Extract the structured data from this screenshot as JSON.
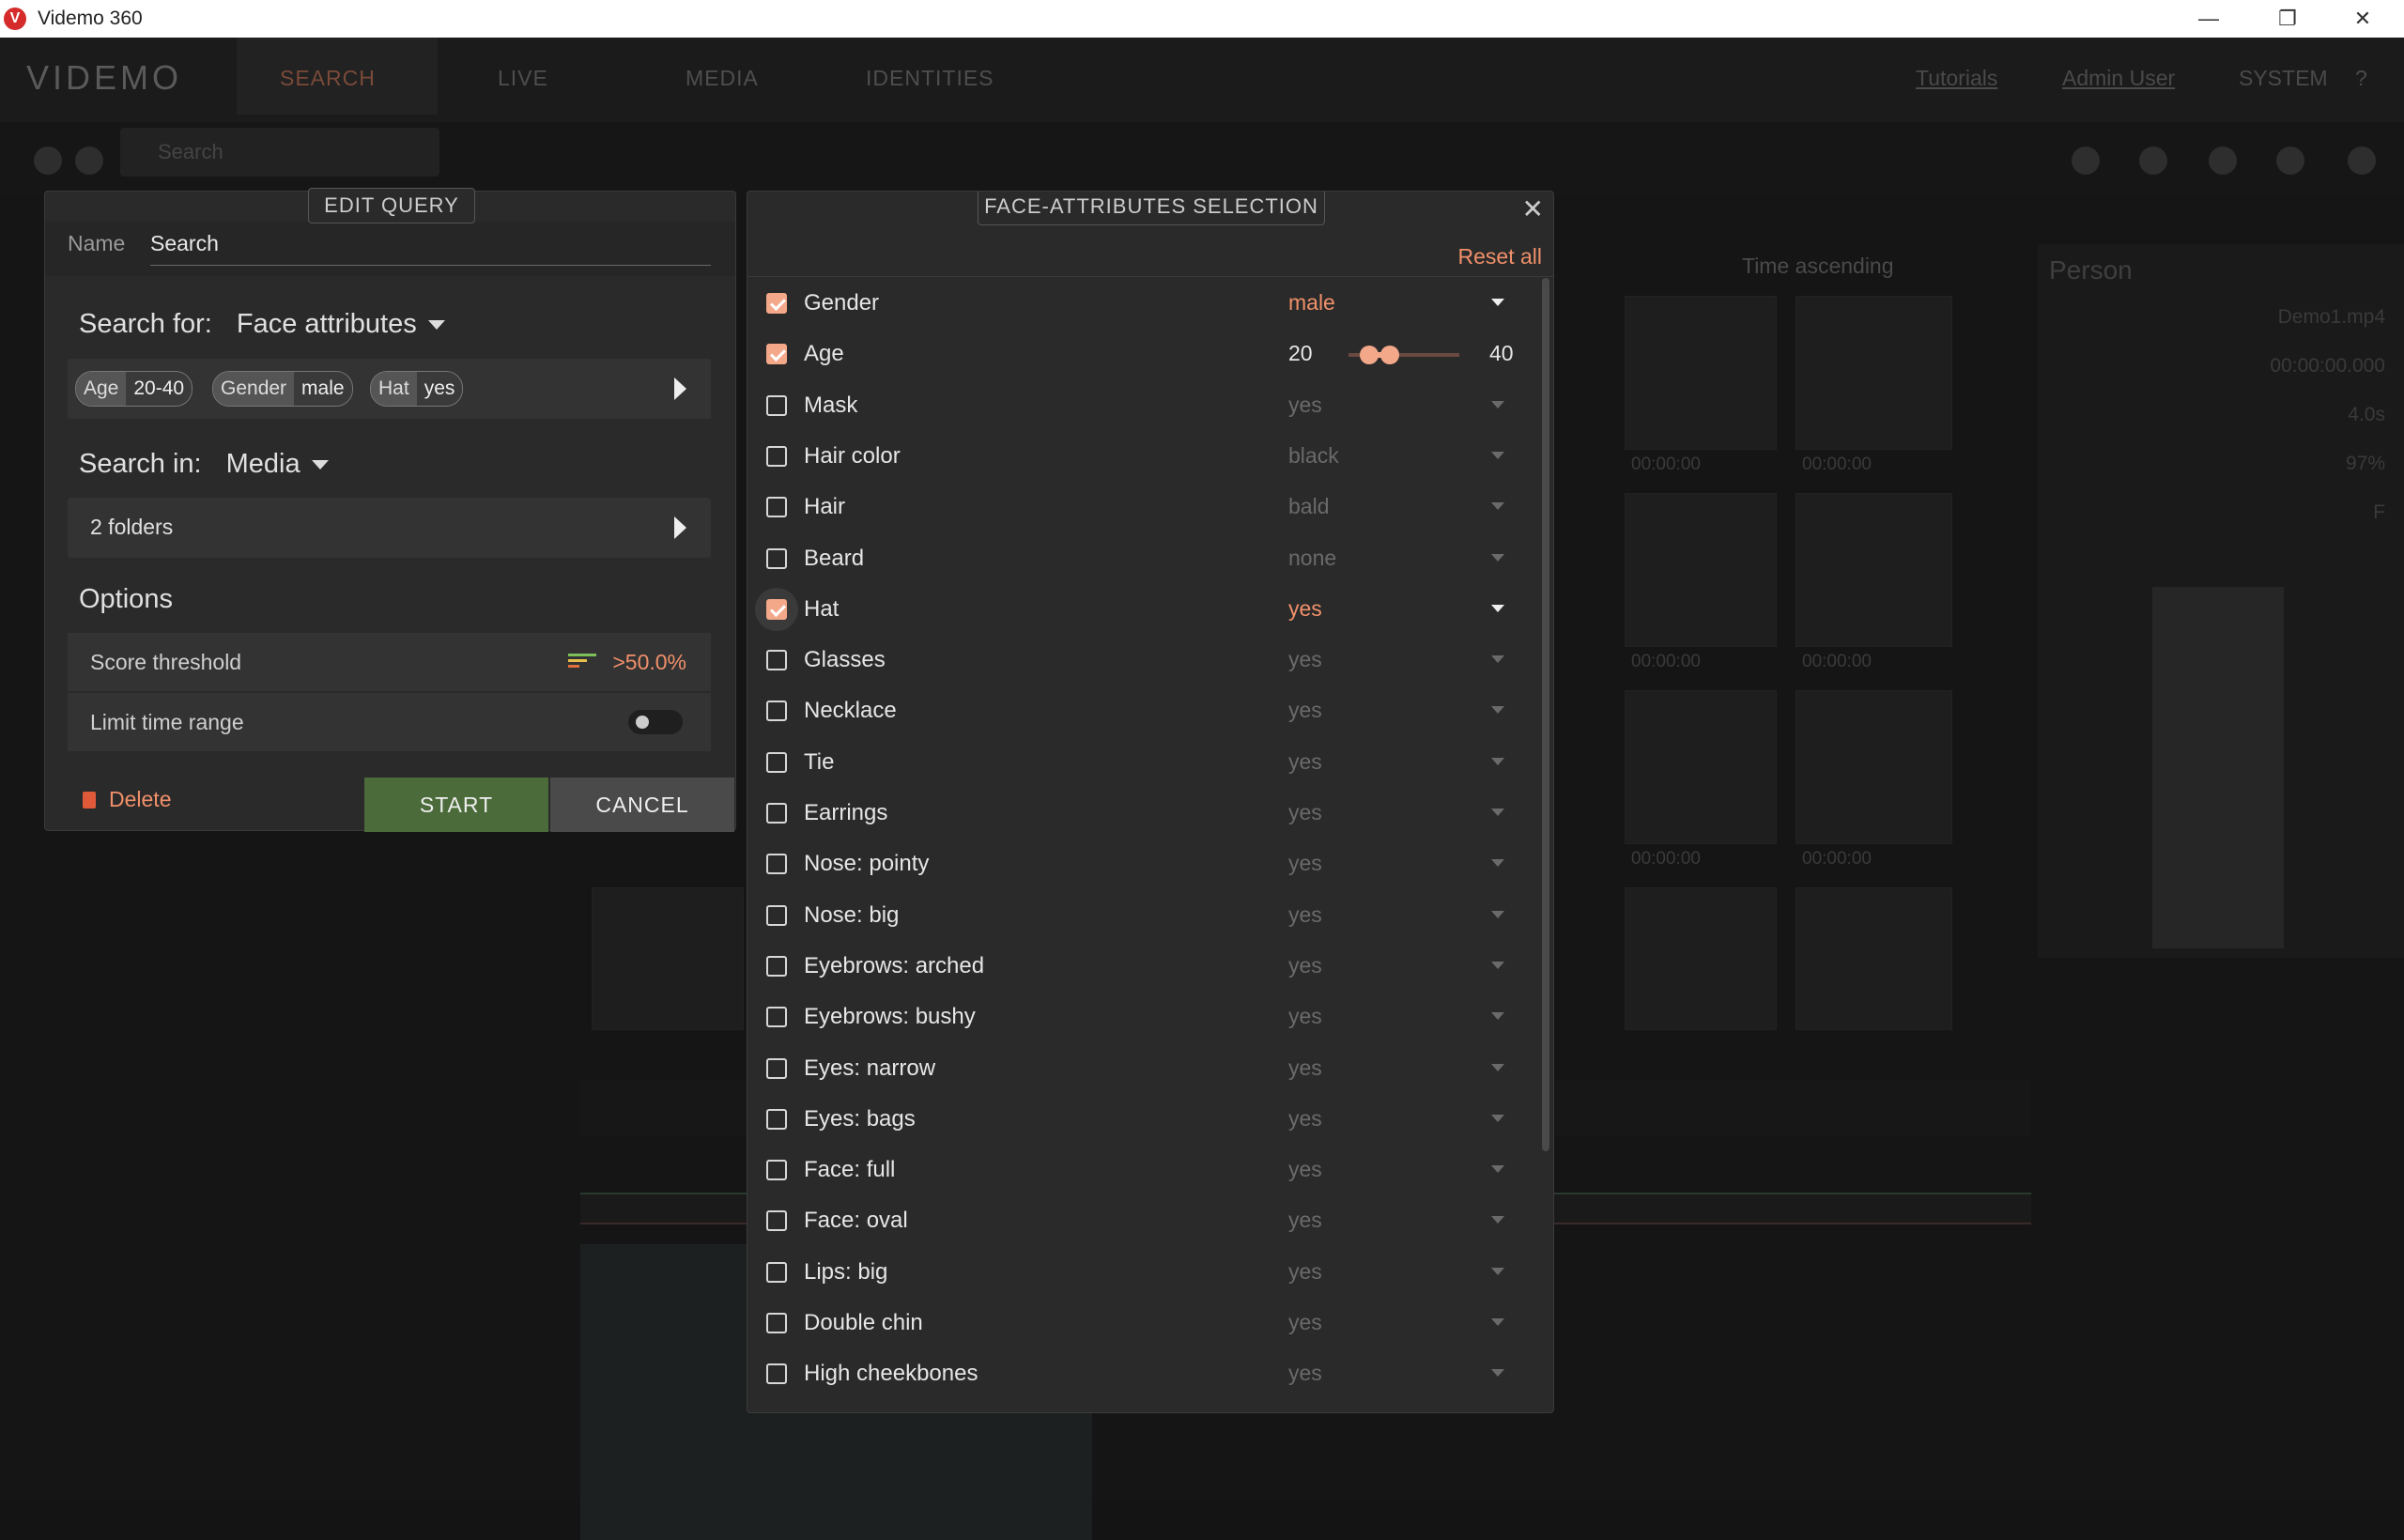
{
  "window": {
    "title": "Videmo 360",
    "logo_letter": "V",
    "minimize": "—",
    "restore": "❐",
    "close": "✕"
  },
  "nav": {
    "brand": "VIDEMO",
    "tabs": [
      {
        "label": "SEARCH"
      },
      {
        "label": "LIVE"
      },
      {
        "label": "MEDIA"
      },
      {
        "label": "IDENTITIES"
      }
    ],
    "tutorials": "Tutorials",
    "user": "Admin User",
    "system": "SYSTEM",
    "help": "?"
  },
  "toolbar": {
    "search_placeholder": "Search",
    "sort_label": "Time ascending"
  },
  "background": {
    "thumb_time": "00:00:00",
    "right_panel": {
      "title": "Person",
      "file": "Demo1.mp4",
      "time": "00:00:00.000",
      "duration": "4.0s",
      "score": "97%",
      "gender": "F"
    }
  },
  "edit_query": {
    "tab_title": "EDIT QUERY",
    "name_label": "Name",
    "name_value": "Search",
    "search_for_label": "Search for:",
    "search_for_value": "Face attributes",
    "chips": [
      {
        "key": "Age",
        "value": "20-40"
      },
      {
        "key": "Gender",
        "value": "male"
      },
      {
        "key": "Hat",
        "value": "yes"
      }
    ],
    "search_in_label": "Search in:",
    "search_in_value": "Media",
    "folders": "2 folders",
    "options_label": "Options",
    "score_label": "Score threshold",
    "score_value": ">50.0%",
    "time_range_label": "Limit time range",
    "time_range_enabled": false,
    "delete": "Delete",
    "start": "START",
    "cancel": "CANCEL"
  },
  "face_attributes": {
    "tab_title": "FACE-ATTRIBUTES SELECTION",
    "close": "✕",
    "reset_all": "Reset all",
    "age": {
      "min": "20",
      "max": "40"
    },
    "items": [
      {
        "label": "Gender",
        "value": "male",
        "checked": true
      },
      {
        "label": "Age",
        "value": "",
        "checked": true
      },
      {
        "label": "Mask",
        "value": "yes",
        "checked": false
      },
      {
        "label": "Hair color",
        "value": "black",
        "checked": false
      },
      {
        "label": "Hair",
        "value": "bald",
        "checked": false
      },
      {
        "label": "Beard",
        "value": "none",
        "checked": false
      },
      {
        "label": "Hat",
        "value": "yes",
        "checked": true
      },
      {
        "label": "Glasses",
        "value": "yes",
        "checked": false
      },
      {
        "label": "Necklace",
        "value": "yes",
        "checked": false
      },
      {
        "label": "Tie",
        "value": "yes",
        "checked": false
      },
      {
        "label": "Earrings",
        "value": "yes",
        "checked": false
      },
      {
        "label": "Nose: pointy",
        "value": "yes",
        "checked": false
      },
      {
        "label": "Nose: big",
        "value": "yes",
        "checked": false
      },
      {
        "label": "Eyebrows: arched",
        "value": "yes",
        "checked": false
      },
      {
        "label": "Eyebrows: bushy",
        "value": "yes",
        "checked": false
      },
      {
        "label": "Eyes: narrow",
        "value": "yes",
        "checked": false
      },
      {
        "label": "Eyes: bags",
        "value": "yes",
        "checked": false
      },
      {
        "label": "Face: full",
        "value": "yes",
        "checked": false
      },
      {
        "label": "Face: oval",
        "value": "yes",
        "checked": false
      },
      {
        "label": "Lips: big",
        "value": "yes",
        "checked": false
      },
      {
        "label": "Double chin",
        "value": "yes",
        "checked": false
      },
      {
        "label": "High cheekbones",
        "value": "yes",
        "checked": false
      }
    ]
  },
  "colors": {
    "accent": "#f0906a",
    "checkbox": "#f4a88a",
    "start": "#4b6b3a",
    "panel": "#2a2a2a"
  }
}
